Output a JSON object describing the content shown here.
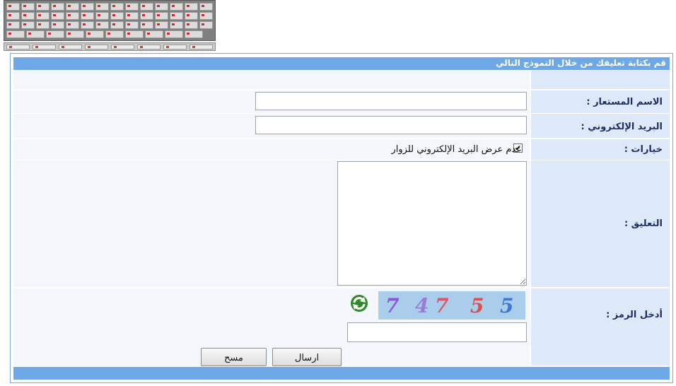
{
  "keyboard": {
    "icon": "virtual-keyboard-icon"
  },
  "form": {
    "title": "قم بكتابة تعليقك من خلال النموذج التالي",
    "name_label": "الاسم المستعار :",
    "email_label": "البريد الإلكتروني :",
    "options_label": "خيارات :",
    "hide_email_label": "عدم عرض البريد الإلكتروني للزوار",
    "hide_email_checked": true,
    "comment_label": "التعليق :",
    "code_label": "أدخل الرمز :",
    "captcha_digits": [
      "7",
      "4",
      "7",
      "5",
      "5"
    ],
    "captcha_colors": [
      "#8a55d6",
      "#9b7ad8",
      "#e05566",
      "#d95050",
      "#3f78d6"
    ],
    "refresh_icon": "refresh-captcha-icon",
    "send_label": "ارسال",
    "clear_label": "مسح",
    "name_value": "",
    "email_value": "",
    "comment_value": "",
    "code_value": ""
  },
  "colors": {
    "header": "#6fa8e6",
    "label_bg": "#dde9f8",
    "field_bg": "#f3f6fb",
    "label_text": "#1f2f66"
  }
}
